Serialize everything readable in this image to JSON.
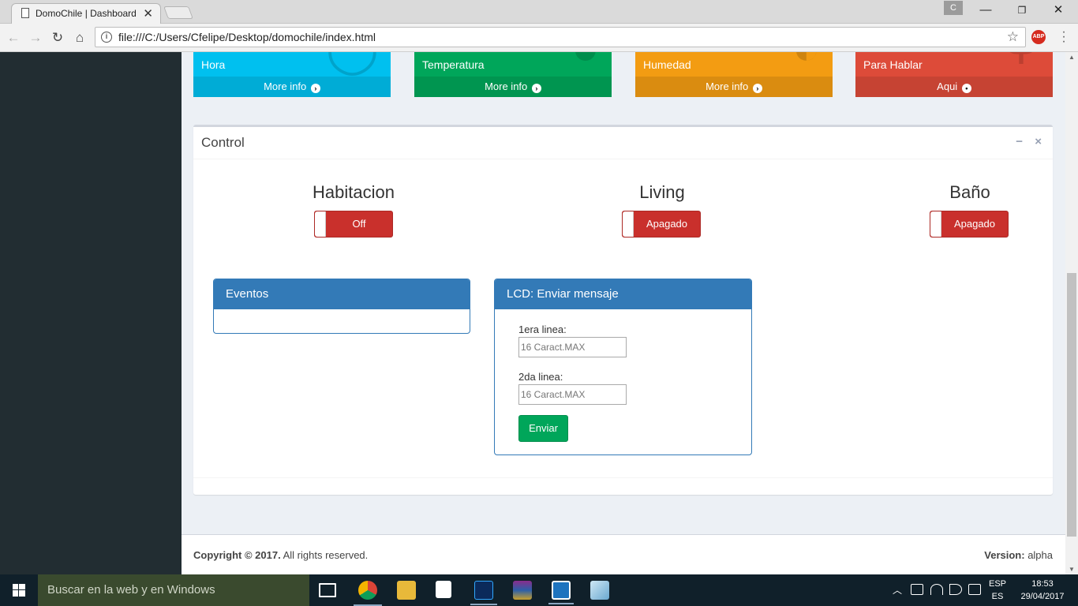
{
  "browser": {
    "tab_title": "DomoChile | Dashboard",
    "url": "file:///C:/Users/Cfelipe/Desktop/domochile/index.html",
    "profile_initial": "C",
    "adblock_label": "ABP"
  },
  "info_boxes": [
    {
      "label": "Hora",
      "footer": "More info",
      "icon": "circle-arrow-right-icon",
      "color": "#00c0ef"
    },
    {
      "label": "Temperatura",
      "footer": "More info",
      "icon": "circle-arrow-right-icon",
      "color": "#00a65a"
    },
    {
      "label": "Humedad",
      "footer": "More info",
      "icon": "circle-arrow-right-icon",
      "color": "#f39c12"
    },
    {
      "label": "Para Hablar",
      "footer": "Aqui",
      "icon": "dot-circle-icon",
      "color": "#dd4b39"
    }
  ],
  "control": {
    "title": "Control",
    "rooms": [
      {
        "name": "Habitacion",
        "state": "Off"
      },
      {
        "name": "Living",
        "state": "Apagado"
      },
      {
        "name": "Baño",
        "state": "Apagado"
      }
    ],
    "events_panel": {
      "title": "Eventos"
    },
    "lcd_panel": {
      "title": "LCD: Enviar mensaje",
      "line1_label": "1era linea:",
      "line1_placeholder": "16 Caract.MAX",
      "line2_label": "2da linea:",
      "line2_placeholder": "16 Caract.MAX",
      "submit_label": "Enviar"
    }
  },
  "footer": {
    "copyright_bold": "Copyright © 2017.",
    "copyright_rest": " All rights reserved.",
    "version_label": "Version:",
    "version_value": " alpha"
  },
  "taskbar": {
    "search_placeholder": "Buscar en la web y en Windows",
    "lang_top": "ESP",
    "lang_bottom": "ES",
    "time": "18:53",
    "date": "29/04/2017"
  }
}
